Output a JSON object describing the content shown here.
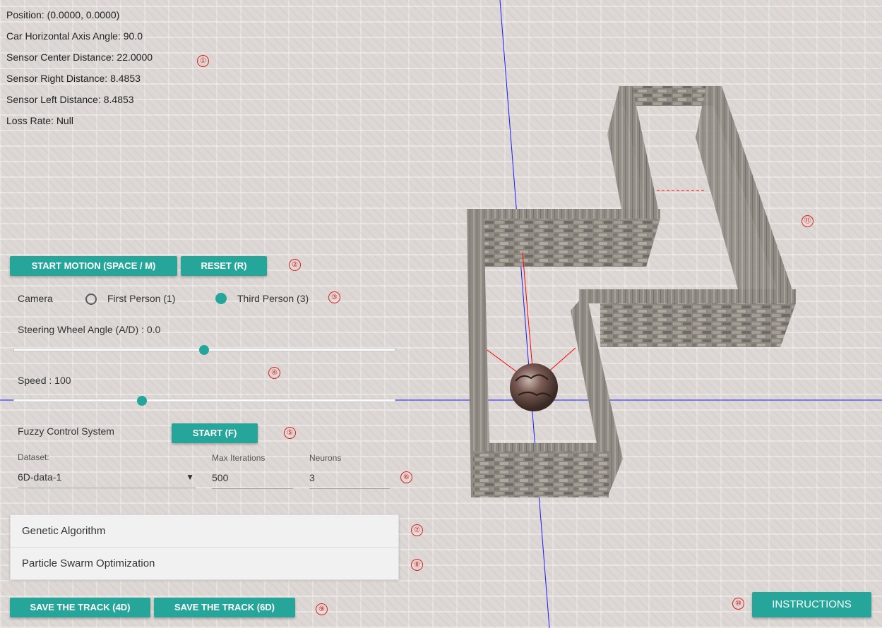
{
  "info": {
    "position": "Position: (0.0000, 0.0000)",
    "angle": "Car Horizontal Axis Angle: 90.0",
    "sensor_center": "Sensor Center Distance: 22.0000",
    "sensor_right": "Sensor Right Distance: 8.4853",
    "sensor_left": "Sensor Left Distance: 8.4853",
    "loss_rate": "Loss Rate: Null"
  },
  "controls": {
    "start_motion": "START MOTION (SPACE / M)",
    "reset": "RESET (R)"
  },
  "camera": {
    "label": "Camera",
    "first_person": "First Person (1)",
    "third_person": "Third Person (3)",
    "selected": "third_person"
  },
  "steering": {
    "label": "Steering Wheel Angle (A/D) : 0.0",
    "value": 0.0,
    "min": -40,
    "max": 40
  },
  "speed": {
    "label": "Speed : 100",
    "value": 100
  },
  "fuzzy": {
    "label": "Fuzzy Control System",
    "start": "START (F)"
  },
  "params": {
    "dataset_label": "Dataset:",
    "dataset_value": "6D-data-1",
    "dropdown_arrow": "▼",
    "max_iter_label": "Max Iterations",
    "max_iter_value": "500",
    "neurons_label": "Neurons",
    "neurons_value": "3"
  },
  "panels": [
    "Genetic Algorithm",
    "Particle Swarm Optimization"
  ],
  "save": {
    "track4d": "SAVE THE TRACK (4D)",
    "track6d": "SAVE THE TRACK (6D)"
  },
  "instructions": "INSTRUCTIONS",
  "callouts": [
    "①",
    "②",
    "③",
    "④",
    "⑤",
    "⑥",
    "⑦",
    "⑧",
    "⑨",
    "⑩",
    "⑪"
  ],
  "colors": {
    "accent": "#26a69a",
    "axis": "#1a1aff",
    "callout": "#dd2222",
    "sensor": "#ff0000"
  }
}
